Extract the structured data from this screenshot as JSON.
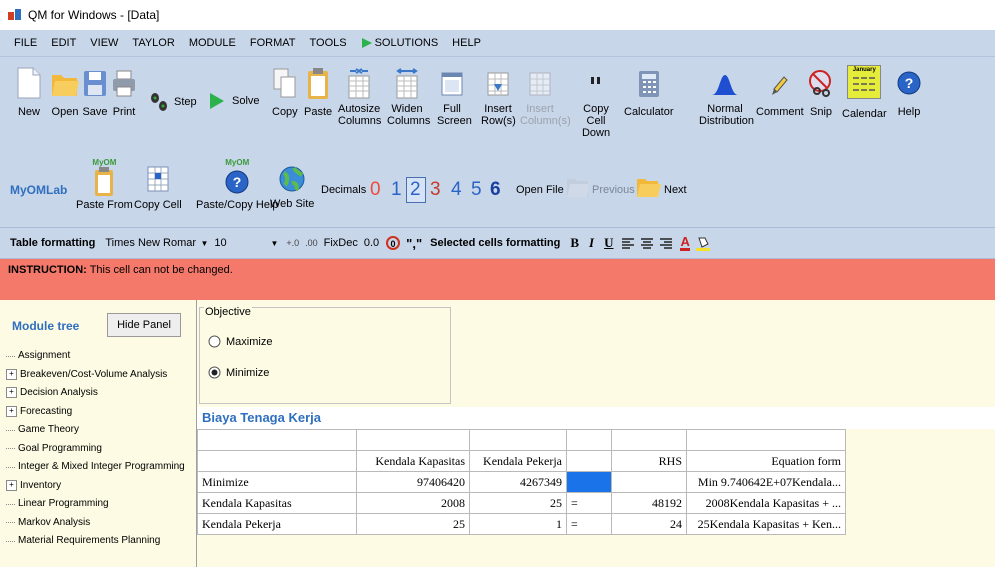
{
  "window": {
    "title": "QM for Windows - [Data]"
  },
  "menu": [
    "FILE",
    "EDIT",
    "VIEW",
    "TAYLOR",
    "MODULE",
    "FORMAT",
    "TOOLS",
    "SOLUTIONS",
    "HELP"
  ],
  "toolbar": {
    "new": "New",
    "open": "Open",
    "save": "Save",
    "print": "Print",
    "step": "Step",
    "solve": "Solve",
    "copy": "Copy",
    "paste": "Paste",
    "autosize": "Autosize Columns",
    "widen": "Widen Columns",
    "full": "Full Screen",
    "insert_rows": "Insert Row(s)",
    "insert_cols": "Insert Column(s)",
    "copy_down": "Copy Cell Down",
    "calculator": "Calculator",
    "normal": "Normal Distribution",
    "comment": "Comment",
    "snip": "Snip",
    "calendar": "Calendar",
    "help": "Help",
    "calendar_icon_text": "January"
  },
  "ribbon2": {
    "myomlab": "MyOMLab",
    "myom_badge": "MyOM",
    "paste_from": "Paste From",
    "copy_cell": "Copy Cell",
    "paste_copy_help": "Paste/Copy Help",
    "web_site": "Web Site",
    "decimals": "Decimals",
    "decimal_values": [
      "0",
      "1",
      "2",
      "3",
      "4",
      "5",
      "6"
    ],
    "open_file": "Open File",
    "previous": "Previous",
    "next": "Next"
  },
  "format_bar": {
    "table_formatting": "Table formatting",
    "font": "Times New Romar",
    "size": "10",
    "fixdec": "FixDec",
    "zero_dec": "0.0",
    "comma_sym": "\",\"",
    "selected_cells": "Selected cells formatting",
    "bold": "B",
    "italic": "I",
    "underline": "U",
    "color_a": "A"
  },
  "instruction": {
    "label": "INSTRUCTION:",
    "text": "This cell can not be changed."
  },
  "module_tree": {
    "title": "Module tree",
    "hide": "Hide Panel",
    "items": [
      {
        "label": "Assignment",
        "expand": false
      },
      {
        "label": "Breakeven/Cost-Volume Analysis",
        "expand": true
      },
      {
        "label": "Decision Analysis",
        "expand": true
      },
      {
        "label": "Forecasting",
        "expand": true
      },
      {
        "label": "Game Theory",
        "expand": false
      },
      {
        "label": "Goal Programming",
        "expand": false
      },
      {
        "label": "Integer & Mixed Integer Programming",
        "expand": false
      },
      {
        "label": "Inventory",
        "expand": true
      },
      {
        "label": "Linear Programming",
        "expand": false
      },
      {
        "label": "Markov Analysis",
        "expand": false
      },
      {
        "label": "Material Requirements Planning",
        "expand": false
      }
    ]
  },
  "objective": {
    "title": "Objective",
    "maximize": "Maximize",
    "minimize": "Minimize",
    "selected": "Minimize"
  },
  "problem": {
    "title": "Biaya Tenaga Kerja"
  },
  "table": {
    "headers": [
      "",
      "Kendala Kapasitas",
      "Kendala Pekerja",
      "",
      "RHS",
      "Equation form"
    ],
    "rows": [
      [
        "Minimize",
        "97406420",
        "4267349",
        "",
        "",
        "Min  9.740642E+07Kendala..."
      ],
      [
        "Kendala Kapasitas",
        "2008",
        "25",
        "=",
        "48192",
        "2008Kendala Kapasitas +  ..."
      ],
      [
        "Kendala Pekerja",
        "25",
        "1",
        "=",
        "24",
        "25Kendala Kapasitas + Ken..."
      ]
    ]
  },
  "colors": {
    "ribbon": "#c8d6ea",
    "instruction": "#f4796a",
    "panel": "#fdfbe4",
    "title_blue": "#2f6fbf",
    "cell_selected": "#1a73e8"
  }
}
